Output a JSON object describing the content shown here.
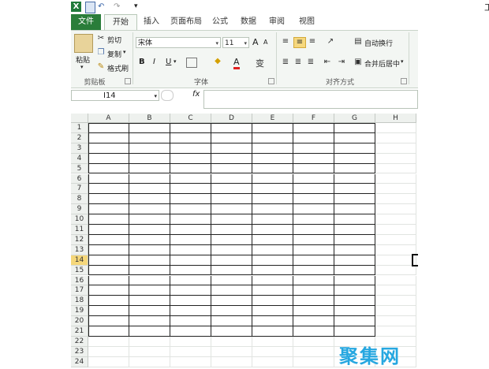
{
  "quick_access": {
    "excel_logo": "X",
    "save_icon": "save-icon",
    "undo_icon": "undo-icon",
    "redo_icon": "redo-icon",
    "customize": "▾",
    "title_partial": "工"
  },
  "tabs": [
    "文件",
    "开始",
    "插入",
    "页面布局",
    "公式",
    "数据",
    "审阅",
    "视图"
  ],
  "clipboard": {
    "paste_label": "粘贴",
    "cut_label": "剪切",
    "copy_label": "复制",
    "format_painter_label": "格式刷",
    "group_label": "剪贴板"
  },
  "font": {
    "font_name": "宋体",
    "font_size": "11",
    "grow": "A",
    "shrink": "A",
    "bold": "B",
    "italic": "I",
    "underline": "U",
    "color_letter": "A",
    "phonetic": "变",
    "group_label": "字体"
  },
  "alignment": {
    "wrap_text_label": "自动换行",
    "merge_center_label": "合并后居中",
    "group_label": "对齐方式"
  },
  "formula_bar": {
    "name_box": "I14",
    "fx": "fx",
    "content": ""
  },
  "sheet": {
    "columns": [
      "A",
      "B",
      "C",
      "D",
      "E",
      "F",
      "G",
      "H"
    ],
    "rows": [
      "1",
      "2",
      "3",
      "4",
      "5",
      "6",
      "7",
      "8",
      "9",
      "10",
      "11",
      "12",
      "13",
      "14",
      "15",
      "16",
      "17",
      "18",
      "19",
      "20",
      "21",
      "22",
      "23",
      "24"
    ],
    "selected_row": "14",
    "bordered_columns": 7,
    "bordered_rows": 21
  },
  "watermark": "聚集网",
  "colors": {
    "file_tab": "#2a7d3a",
    "selected_row": "#f5d77a",
    "watermark": "#26a7e0"
  }
}
